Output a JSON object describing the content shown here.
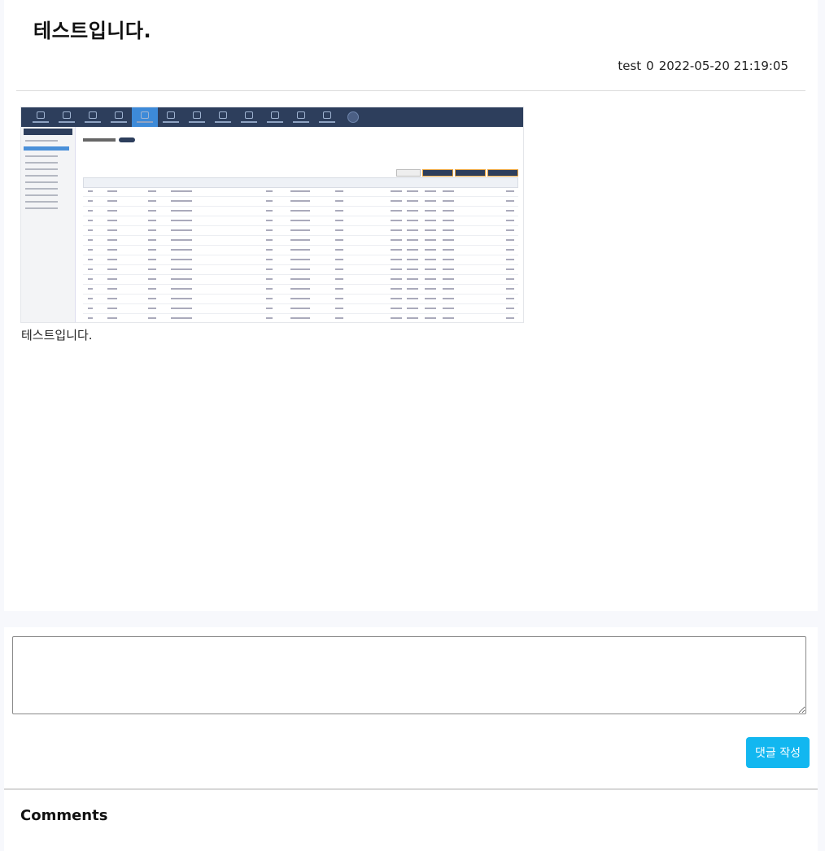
{
  "post": {
    "title": "테스트입니다.",
    "author": "test",
    "views": "0",
    "date": "2022-05-20 21:19:05",
    "body": "테스트입니다."
  },
  "comment_form": {
    "placeholder": "",
    "submit_label": "댓글 작성"
  },
  "comments": {
    "heading": "Comments"
  },
  "colors": {
    "accent": "#12b7f0",
    "page_bg": "#f7f8fc",
    "card_bg": "#ffffff"
  }
}
